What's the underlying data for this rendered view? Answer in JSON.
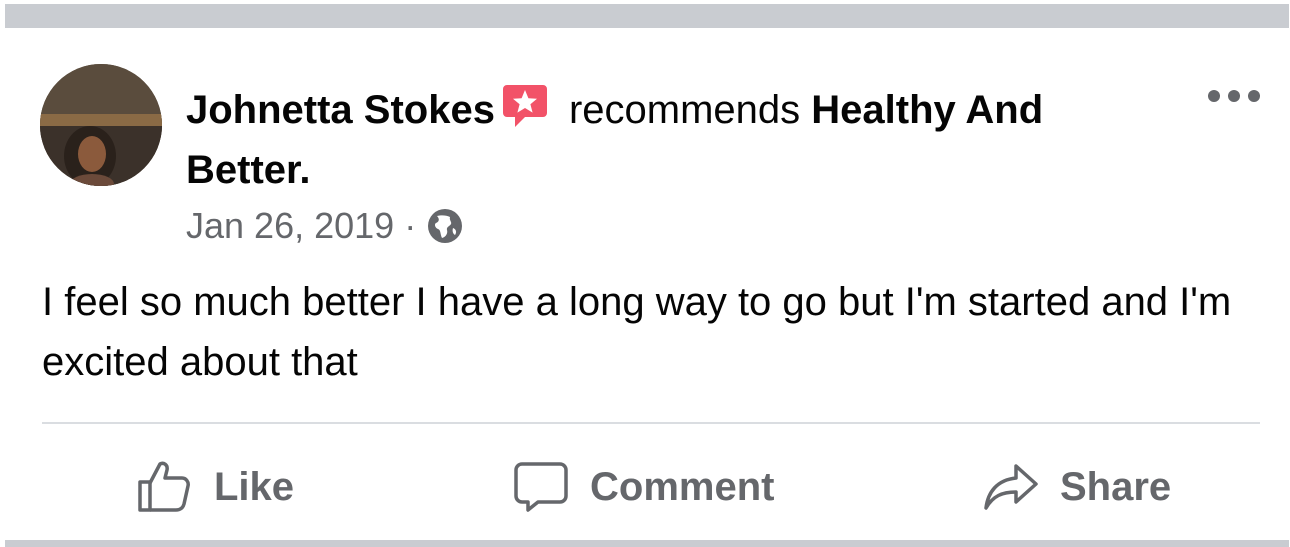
{
  "post": {
    "author": "Johnetta Stokes",
    "action_text": "recommends",
    "page_name": "Healthy And Better.",
    "date": "Jan 26, 2019",
    "separator": "·",
    "body": "I feel so much better I have a long way to go but I'm started and I'm excited about that",
    "icons": {
      "recommend": "recommendation-star-icon",
      "audience": "globe-icon",
      "more": "more-options-icon"
    }
  },
  "actions": {
    "like_label": "Like",
    "comment_label": "Comment",
    "share_label": "Share"
  },
  "colors": {
    "text_primary": "#050505",
    "text_secondary": "#65676b",
    "recommend_badge": "#f25268",
    "separator": "#c9ccd1",
    "divider": "#dadde1"
  }
}
